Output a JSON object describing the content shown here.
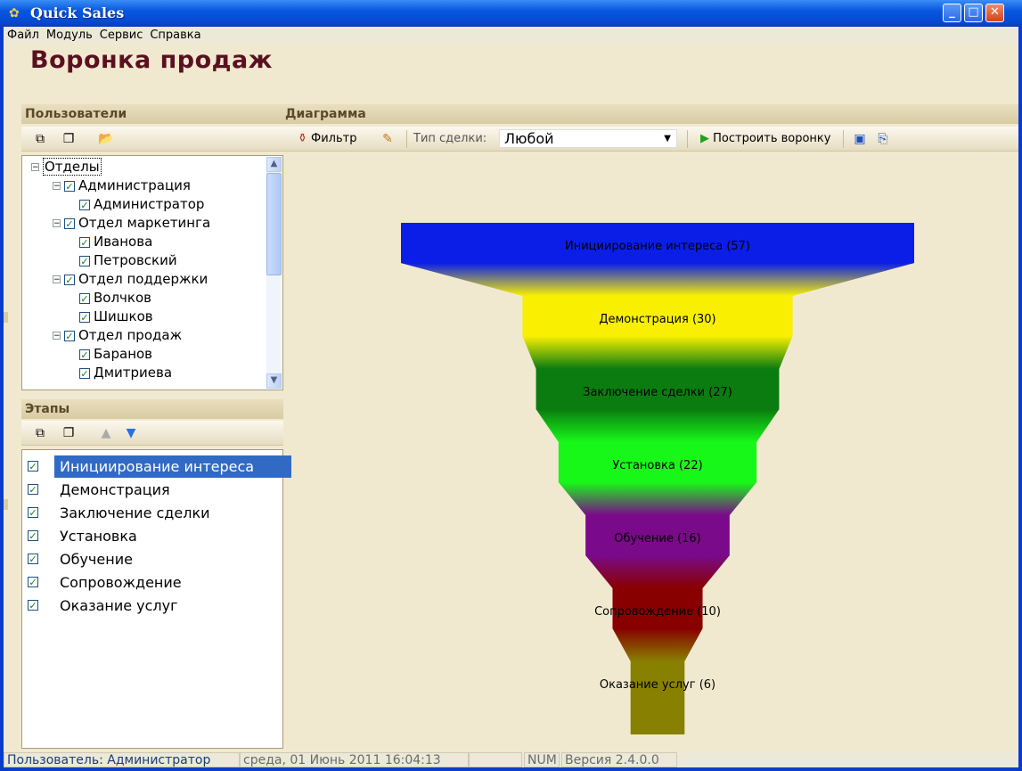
{
  "window": {
    "title": "Quick Sales"
  },
  "menu": [
    "Файл",
    "Модуль",
    "Сервис",
    "Справка"
  ],
  "page_title": "Воронка продаж",
  "users_panel": {
    "header": "Пользователи",
    "tree": [
      {
        "label": "Отделы",
        "level": 0,
        "checkbox": false,
        "expander": true
      },
      {
        "label": "Администрация",
        "level": 1,
        "checkbox": true,
        "expander": true
      },
      {
        "label": "Администратор",
        "level": 2,
        "checkbox": true,
        "expander": false
      },
      {
        "label": "Отдел маркетинга",
        "level": 1,
        "checkbox": true,
        "expander": true
      },
      {
        "label": "Иванова",
        "level": 2,
        "checkbox": true,
        "expander": false
      },
      {
        "label": "Петровский",
        "level": 2,
        "checkbox": true,
        "expander": false
      },
      {
        "label": "Отдел поддержки",
        "level": 1,
        "checkbox": true,
        "expander": true
      },
      {
        "label": "Волчков",
        "level": 2,
        "checkbox": true,
        "expander": false
      },
      {
        "label": "Шишков",
        "level": 2,
        "checkbox": true,
        "expander": false
      },
      {
        "label": "Отдел продаж",
        "level": 1,
        "checkbox": true,
        "expander": true
      },
      {
        "label": "Баранов",
        "level": 2,
        "checkbox": true,
        "expander": false
      },
      {
        "label": "Дмитриева",
        "level": 2,
        "checkbox": true,
        "expander": false
      }
    ]
  },
  "stages_panel": {
    "header": "Этапы",
    "items": [
      {
        "label": "Инициирование интереса",
        "checked": true,
        "selected": true
      },
      {
        "label": "Демонстрация",
        "checked": true,
        "selected": false
      },
      {
        "label": "Заключение сделки",
        "checked": true,
        "selected": false
      },
      {
        "label": "Установка",
        "checked": true,
        "selected": false
      },
      {
        "label": "Обучение",
        "checked": true,
        "selected": false
      },
      {
        "label": "Сопровождение",
        "checked": true,
        "selected": false
      },
      {
        "label": "Оказание услуг",
        "checked": true,
        "selected": false
      }
    ]
  },
  "diagram": {
    "header": "Диаграмма",
    "filter_label": "Фильтр",
    "deal_type_label": "Тип сделки:",
    "deal_type_value": "Любой",
    "build_label": "Построить воронку"
  },
  "chart_data": {
    "type": "funnel",
    "stages": [
      {
        "label": "Инициирование интереса (57)",
        "value": 57,
        "color": "#0a1ee8"
      },
      {
        "label": "Демонстрация (30)",
        "value": 30,
        "color": "#f8f000"
      },
      {
        "label": "Заключение сделки (27)",
        "value": 27,
        "color": "#0a7c10"
      },
      {
        "label": "Установка (22)",
        "value": 22,
        "color": "#18f818"
      },
      {
        "label": "Обучение (16)",
        "value": 16,
        "color": "#7a0a8a"
      },
      {
        "label": "Сопровождение (10)",
        "value": 10,
        "color": "#880000"
      },
      {
        "label": "Оказание услуг (6)",
        "value": 6,
        "color": "#888000"
      }
    ]
  },
  "status": {
    "user": "Пользователь: Администратор",
    "date": "среда, 01 Июнь 2011 16:04:13",
    "num": "NUM",
    "version": "Версия 2.4.0.0"
  }
}
